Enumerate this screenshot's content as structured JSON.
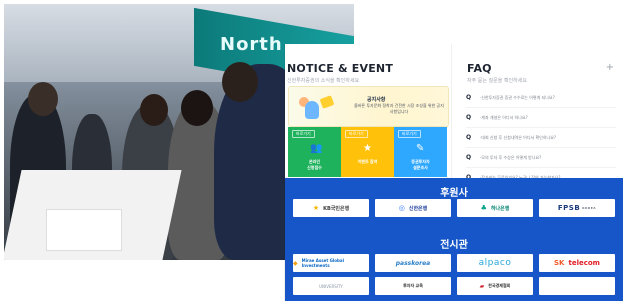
{
  "photo": {
    "sign_text": "North"
  },
  "notice": {
    "title": "NOTICE & EVENT",
    "subtitle": "신한투자증권의 소식을 확인하세요",
    "banner": {
      "heading": "공지사항",
      "desc": "올바른 투자문화 정착과 건전한 시장 조성을 위한 공지사항입니다"
    },
    "tiles": [
      {
        "tag": "바로가기",
        "icon": "👥",
        "label": "온라인\n신청접수",
        "bg": "#1fb25c"
      },
      {
        "tag": "바로가기",
        "icon": "★",
        "label": "이벤트 참여",
        "bg": "#ffc10a"
      },
      {
        "tag": "바로가기",
        "icon": "✎",
        "label": "증권투자자\n설문조사",
        "bg": "#2ea7ff"
      }
    ]
  },
  "faq": {
    "title": "FAQ",
    "subtitle": "자주 묻는 질문을 확인하세요",
    "more": "+",
    "items": [
      {
        "q": "Q",
        "text": "·신한투자증권 증권 수수료는 어떻게 되나요?"
      },
      {
        "q": "Q",
        "text": "·계좌 개설은 어디서 하나요?"
      },
      {
        "q": "Q",
        "text": "·대회 신청 후 신청내역은 어디서 확인하나요?"
      },
      {
        "q": "Q",
        "text": "·모의 투자 후 수상은 어떻게 받나요?"
      },
      {
        "q": "Q",
        "text": "·참가비는 무료인가요? 누구나 참여 가능한가요?"
      }
    ]
  },
  "sponsor": {
    "title_sponsors": "후원사",
    "title_exhibitors": "전시관",
    "sponsors": [
      {
        "id": "kb",
        "mark": "★",
        "name": "KB국민은행"
      },
      {
        "id": "shinhan",
        "mark": "◎",
        "name": "신한은행"
      },
      {
        "id": "hana",
        "mark": "♣",
        "name": "하나은행"
      },
      {
        "id": "fpsb",
        "mark": "",
        "name": "FPSB",
        "small": "KOREA"
      }
    ],
    "exhibitors_row1": [
      {
        "id": "mirae",
        "mark": "◆",
        "name": "Mirae Asset Global Investments"
      },
      {
        "id": "passkorea",
        "mark": "",
        "name": "passkorea"
      },
      {
        "id": "alpaco",
        "mark": "",
        "name": "alpaco"
      },
      {
        "id": "sk",
        "mark": "SK",
        "name": "telecom"
      }
    ],
    "exhibitors_row2": [
      {
        "id": "small-grey",
        "mark": "",
        "name": "UNIVERSITY"
      },
      {
        "id": "edutext",
        "mark": "",
        "name": "투자자\n교육"
      },
      {
        "id": "kmea",
        "mark": "▰",
        "name": "한국경제협회"
      },
      {
        "id": "blank",
        "mark": "",
        "name": ""
      }
    ]
  }
}
